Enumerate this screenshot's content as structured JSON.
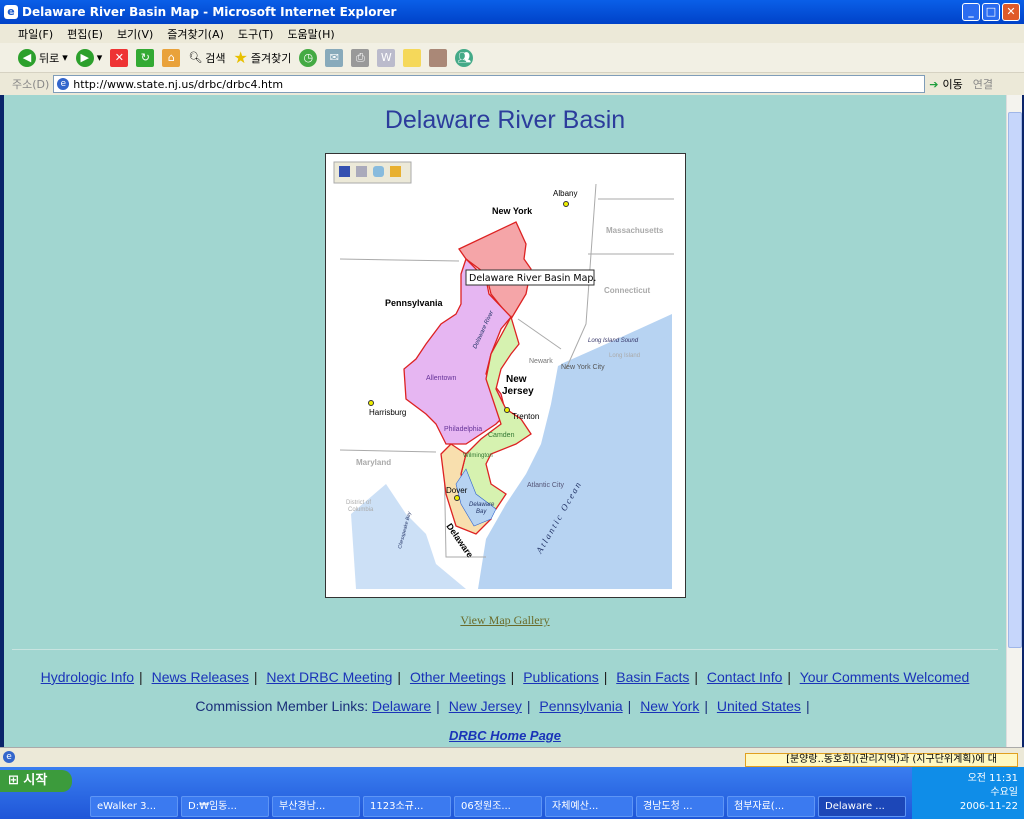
{
  "window": {
    "title": "Delaware River Basin Map - Microsoft Internet Explorer"
  },
  "menu": [
    "파일(F)",
    "편집(E)",
    "보기(V)",
    "즐겨찾기(A)",
    "도구(T)",
    "도움말(H)"
  ],
  "toolbar": {
    "back": "뒤로",
    "search": "검색",
    "favorites": "즐겨찾기"
  },
  "address": {
    "label": "주소(D)",
    "url": "http://www.state.nj.us/drbc/drbc4.htm",
    "go": "이동",
    "links": "연결"
  },
  "page": {
    "title": "Delaware River Basin",
    "map": {
      "tooltip": "Delaware River Basin Map.",
      "labels": {
        "ny": "New York",
        "pa": "Pennsylvania",
        "nj1": "New",
        "nj2": "Jersey",
        "de": "Delaware",
        "ma": "Massachusetts",
        "ct": "Connecticut",
        "md": "Maryland",
        "dc1": "District of",
        "dc2": "Columbia",
        "albany": "Albany",
        "harrisburg": "Harrisburg",
        "allentown": "Allentown",
        "philadelphia": "Philadelphia",
        "camden": "Camden",
        "trenton": "Trenton",
        "newark": "Newark",
        "nyc": "New York City",
        "wilmington": "Wilmington",
        "dover": "Dover",
        "atlantic_city": "Atlantic City",
        "ocean": "Atlantic Ocean",
        "bay1": "Delaware",
        "bay2": "Bay",
        "river": "Delaware River",
        "lis": "Long Island Sound",
        "li": "Long Island",
        "chesapeake": "Chesapeake Bay"
      }
    },
    "gallery": "View Map Gallery",
    "nav": [
      "Hydrologic Info",
      "News Releases",
      "Next DRBC Meeting",
      "Other Meetings",
      "Publications",
      "Basin Facts",
      "Contact Info",
      "Your Comments Welcomed"
    ],
    "member_label": "Commission Member Links:",
    "members": [
      "Delaware",
      "New Jersey",
      "Pennsylvania",
      "New York",
      "United States"
    ],
    "home": "DRBC Home Page"
  },
  "status": {
    "notice": "[분양랑..동호회](관리지역)과 (지구단위계획)에 대"
  },
  "taskbar": {
    "start": "시작",
    "tasks": [
      "eWalker 3...",
      "D:₩임동...",
      "부산경남...",
      "1123소규...",
      "06정원조...",
      "자체예산...",
      "경남도청 ...",
      "첨부자료(...",
      "Delaware ..."
    ],
    "time": "오전 11:31",
    "day": "수요일",
    "date": "2006-11-22"
  }
}
